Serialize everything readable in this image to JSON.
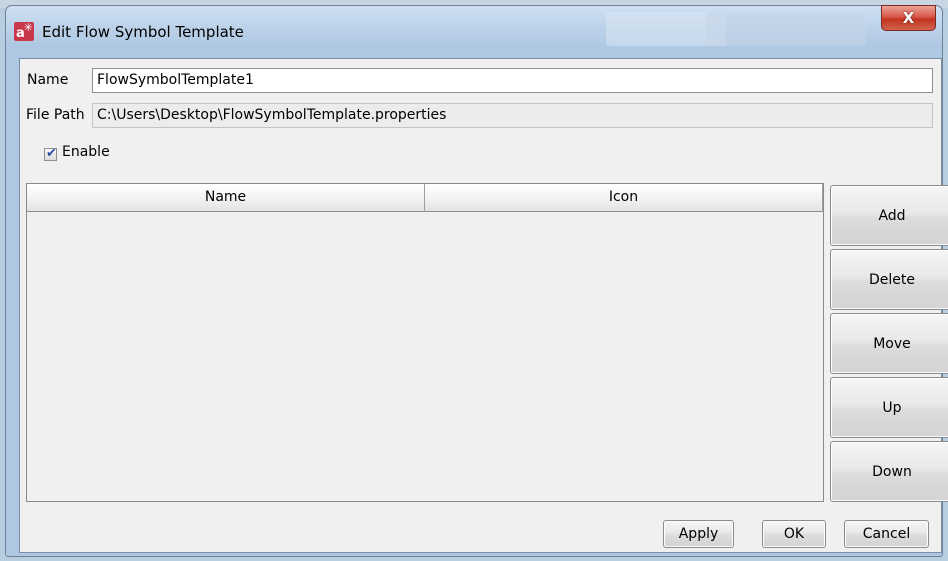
{
  "window": {
    "title": "Edit Flow Symbol Template",
    "close_glyph": "X",
    "icon": "app-logo-icon"
  },
  "form": {
    "name_label": "Name",
    "name_value": "FlowSymbolTemplate1",
    "path_label": "File Path",
    "path_value": "C:\\Users\\Desktop\\FlowSymbolTemplate.properties",
    "enable_label": "Enable",
    "enable_checked": true
  },
  "table": {
    "columns": [
      "Name",
      "Icon"
    ],
    "rows": []
  },
  "side_buttons": [
    "Add",
    "Delete",
    "Move",
    "Up",
    "Down"
  ],
  "footer_buttons": {
    "apply": "Apply",
    "ok": "OK",
    "cancel": "Cancel"
  }
}
